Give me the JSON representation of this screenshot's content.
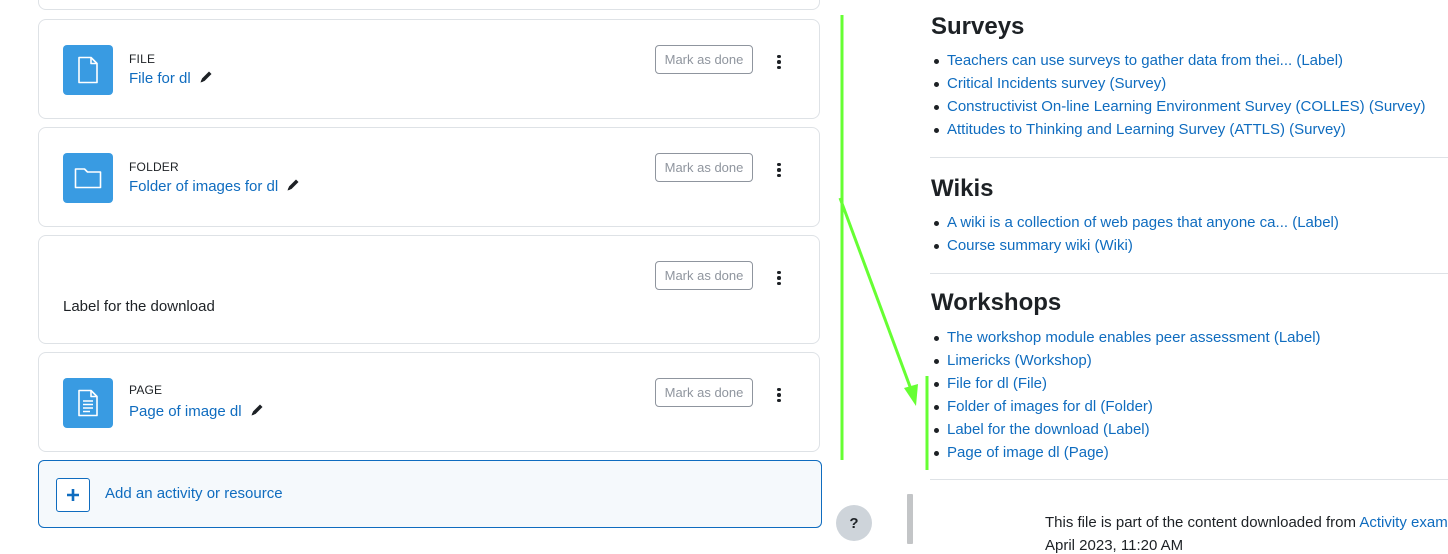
{
  "activities": [
    {
      "type": "FILE",
      "name": "File for dl",
      "icon": "file-icon"
    },
    {
      "type": "FOLDER",
      "name": "Folder of images for dl",
      "icon": "folder-icon"
    },
    {
      "label": "Label for the download"
    },
    {
      "type": "PAGE",
      "name": "Page of image dl",
      "icon": "page-icon"
    }
  ],
  "mark_done_label": "Mark as done",
  "add_activity_label": "Add an activity or resource",
  "help_label": "?",
  "sections": [
    {
      "title": "Surveys",
      "items": [
        "Teachers can use surveys to gather data from thei... (Label)",
        "Critical Incidents survey (Survey)",
        "Constructivist On-line Learning Environment Survey (COLLES) (Survey)",
        "Attitudes to Thinking and Learning Survey (ATTLS) (Survey)"
      ]
    },
    {
      "title": "Wikis",
      "items": [
        "A wiki is a collection of web pages that anyone ca... (Label)",
        "Course summary wiki (Wiki)"
      ]
    },
    {
      "title": "Workshops",
      "items": [
        "The workshop module enables peer assessment (Label)",
        "Limericks (Workshop)",
        "File for dl (File)",
        "Folder of images for dl (Folder)",
        "Label for the download (Label)",
        "Page of image dl (Page)"
      ]
    }
  ],
  "footer": {
    "text": "This file is part of the content downloaded from ",
    "link": "Activity examp",
    "date": "April 2023, 11:20 AM"
  },
  "colors": {
    "link": "#0f6cbf",
    "icon_bg": "#399be2",
    "annotation": "#66ff33"
  }
}
